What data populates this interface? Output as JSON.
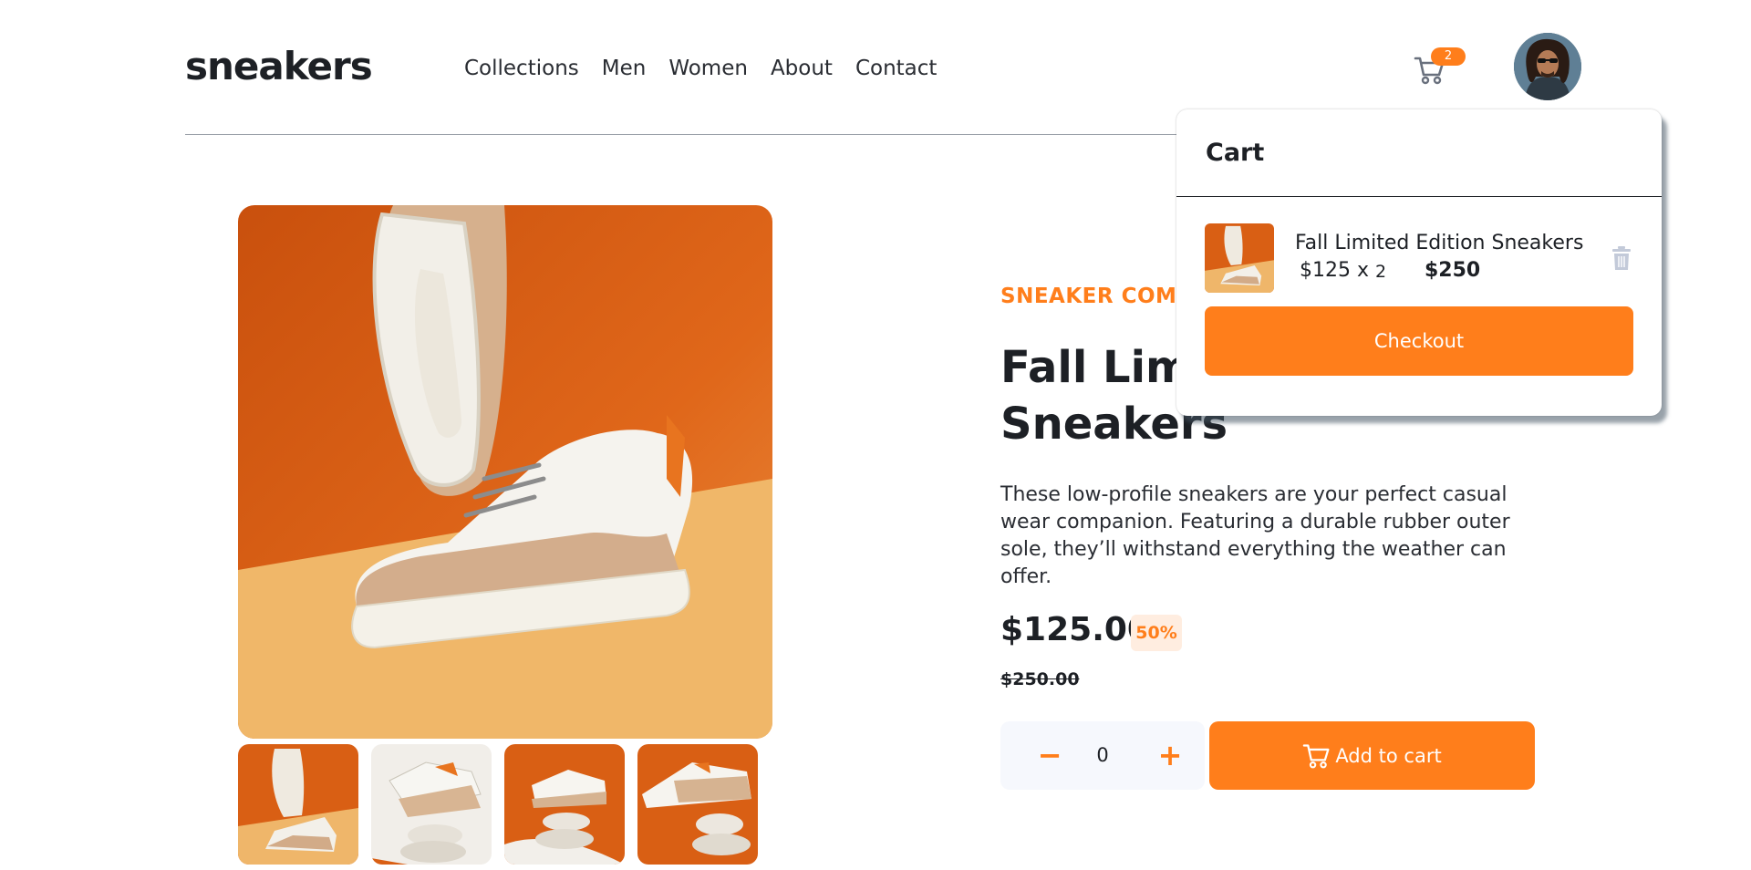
{
  "brand": {
    "logo": "sneakers",
    "accent": "#ff7e1b"
  },
  "nav": [
    "Collections",
    "Men",
    "Women",
    "About",
    "Contact"
  ],
  "header": {
    "cart_count": "2",
    "cart_icon": "cart-icon",
    "avatar": "user-avatar"
  },
  "product": {
    "company": "SNEAKER COMPANY",
    "title": "Fall Limited Edition Sneakers",
    "description": "These low-profile sneakers are your perfect casual wear companion. Featuring a durable rubber outer sole, they’ll withstand everything the weather can offer.",
    "price": "$125.00",
    "discount": "50%",
    "old_price": "$250.00",
    "quantity": "0",
    "minus": "−",
    "plus": "+",
    "add_to_cart": "Add to cart"
  },
  "cart": {
    "title": "Cart",
    "item_name": "Fall Limited Edition Sneakers",
    "item_unit": "$125 x",
    "item_qty": "2",
    "item_total": "$250",
    "checkout": "Checkout"
  }
}
